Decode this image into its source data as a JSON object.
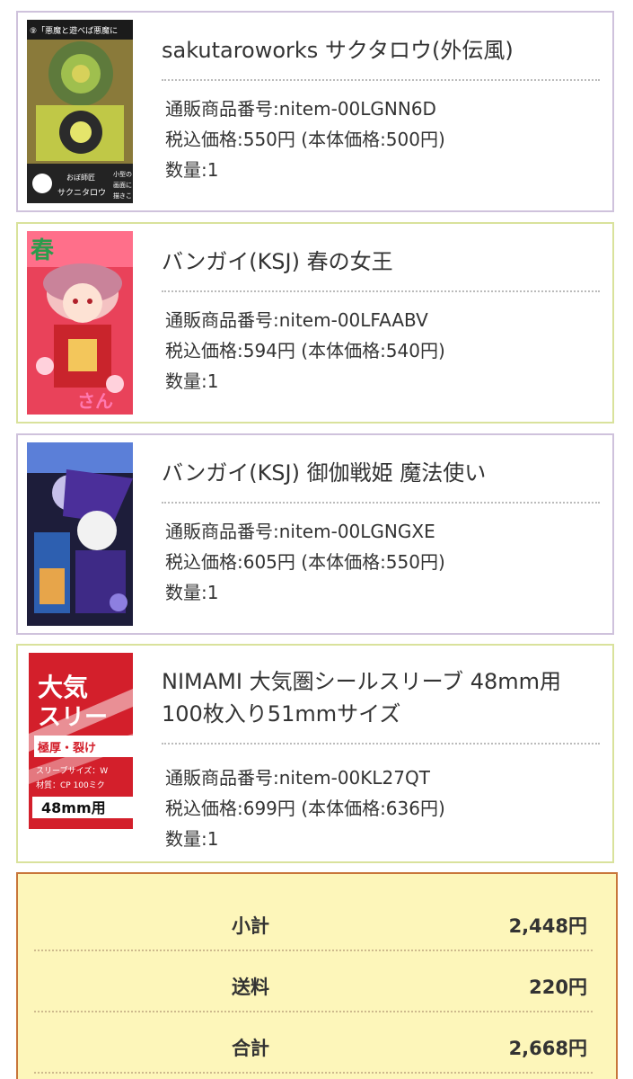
{
  "items": [
    {
      "name": "sakutaroworks サクタロウ(外伝風)",
      "code": "通販商品番号:nitem-00LGNN6D",
      "price": "税込価格:550円 (本体価格:500円)",
      "qty": "数量:1",
      "image_texts": [
        "⑨「悪魔と遊べば悪魔に",
        "おぼ師匠",
        "サクニタロウ",
        "小型の",
        "画面に",
        "描きこ"
      ]
    },
    {
      "name": "バンガイ(KSJ) 春の女王",
      "code": "通販商品番号:nitem-00LFAABV",
      "price": "税込価格:594円 (本体価格:540円)",
      "qty": "数量:1",
      "image_texts": [
        "春",
        "さん"
      ]
    },
    {
      "name": "バンガイ(KSJ) 御伽戦姫 魔法使い",
      "code": "通販商品番号:nitem-00LGNGXE",
      "price": "税込価格:605円 (本体価格:550円)",
      "qty": "数量:1",
      "image_texts": []
    },
    {
      "name": "NIMAMI 大気圏シールスリーブ 48mm用 100枚入り51mmサイズ",
      "code": "通販商品番号:nitem-00KL27QT",
      "price": "税込価格:699円 (本体価格:636円)",
      "qty": "数量:1",
      "image_texts": [
        "大気",
        "スリー",
        "極厚・裂け",
        "スリーブサイズ：W",
        "材質：CP 100ミク",
        "48mm用"
      ]
    }
  ],
  "summary": [
    {
      "label": "小計",
      "value": "2,448円"
    },
    {
      "label": "送料",
      "value": "220円"
    },
    {
      "label": "合計",
      "value": "2,668円"
    }
  ],
  "colors": {
    "item_border_purple": "#cfc2dc",
    "item_border_green": "#d9e29c",
    "summary_bg": "#fdf6ba",
    "summary_border": "#c8763a"
  }
}
